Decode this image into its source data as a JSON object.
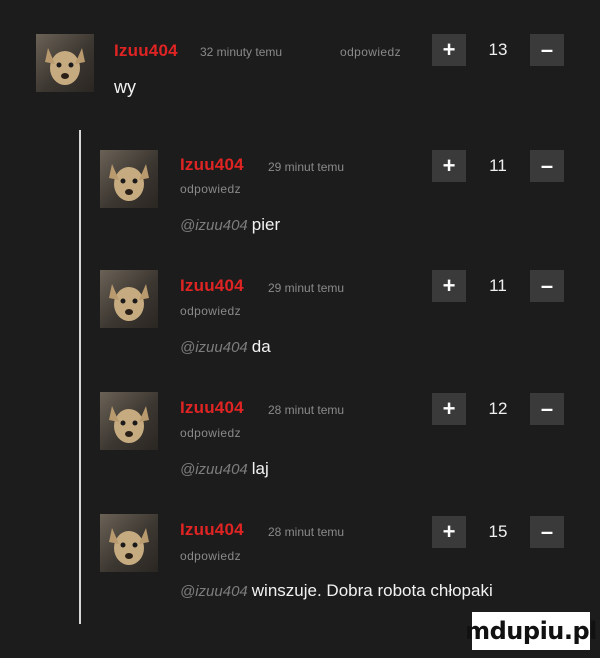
{
  "comments": [
    {
      "author": "Izuu404",
      "time": "32 minuty temu",
      "reply": "odpowiedz",
      "mention": "",
      "text": "wy",
      "score": "13",
      "plus": "+",
      "minus": "–"
    },
    {
      "author": "Izuu404",
      "time": "29 minut temu",
      "reply": "odpowiedz",
      "mention": "@izuu404",
      "text": "pier",
      "score": "11",
      "plus": "+",
      "minus": "–"
    },
    {
      "author": "Izuu404",
      "time": "29 minut temu",
      "reply": "odpowiedz",
      "mention": "@izuu404",
      "text": "da",
      "score": "11",
      "plus": "+",
      "minus": "–"
    },
    {
      "author": "Izuu404",
      "time": "28 minut temu",
      "reply": "odpowiedz",
      "mention": "@izuu404",
      "text": "laj",
      "score": "12",
      "plus": "+",
      "minus": "–"
    },
    {
      "author": "Izuu404",
      "time": "28 minut temu",
      "reply": "odpowiedz",
      "mention": "@izuu404",
      "text": "winszuje. Dobra robota chłopaki",
      "score": "15",
      "plus": "+",
      "minus": "–"
    }
  ],
  "watermark": "mdupiu.pl",
  "colors": {
    "background": "#1c1c1c",
    "author": "#e02424",
    "meta": "#8a8a8a",
    "vote_button": "#3a3a3a",
    "thread_line": "#d8d8d8"
  },
  "icons": {
    "avatar": "dog-avatar-icon",
    "upvote": "plus-icon",
    "downvote": "minus-icon"
  }
}
